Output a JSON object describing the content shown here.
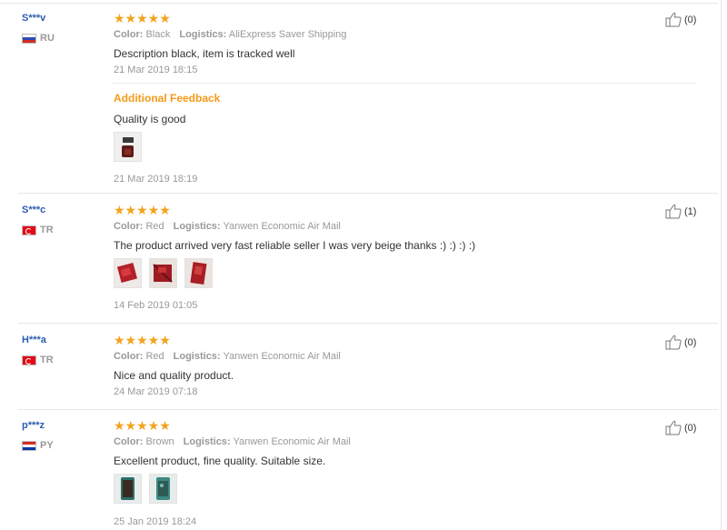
{
  "reviews": [
    {
      "user": "S***v",
      "country_code": "RU",
      "flag": "russia-flag",
      "rating": "★★★★★",
      "color_label": "Color:",
      "color_value": "Black",
      "logistics_label": "Logistics:",
      "logistics_value": "AliExpress Saver Shipping",
      "text": "Description black, item is tracked well",
      "date": "21 Mar 2019 18:15",
      "additional_title": "Additional Feedback",
      "additional_text": "Quality is good",
      "additional_date": "21 Mar 2019 18:19",
      "likes": "(0)"
    },
    {
      "user": "S***c",
      "country_code": "TR",
      "flag": "turkey-flag",
      "rating": "★★★★★",
      "color_label": "Color:",
      "color_value": "Red",
      "logistics_label": "Logistics:",
      "logistics_value": "Yanwen Economic Air Mail",
      "text": "The product arrived very fast reliable seller I was very beige thanks :) :) :) :)",
      "date": "14 Feb 2019 01:05",
      "likes": "(1)"
    },
    {
      "user": "H***a",
      "country_code": "TR",
      "flag": "turkey-flag",
      "rating": "★★★★★",
      "color_label": "Color:",
      "color_value": "Red",
      "logistics_label": "Logistics:",
      "logistics_value": "Yanwen Economic Air Mail",
      "text": "Nice and quality product.",
      "date": "24 Mar 2019 07:18",
      "likes": "(0)"
    },
    {
      "user": "p***z",
      "country_code": "PY",
      "flag": "paraguay-flag",
      "rating": "★★★★★",
      "color_label": "Color:",
      "color_value": "Brown",
      "logistics_label": "Logistics:",
      "logistics_value": "Yanwen Economic Air Mail",
      "text": "Excellent product, fine quality. Suitable size.",
      "date": "25 Jan 2019 18:24",
      "likes": "(0)"
    }
  ],
  "icons": {
    "like": "thumbs-up-icon",
    "star": "star-icon"
  },
  "colors": {
    "star": "#f4a21c",
    "username": "#2a5db0",
    "additional": "#f59a16",
    "muted": "#999999"
  }
}
